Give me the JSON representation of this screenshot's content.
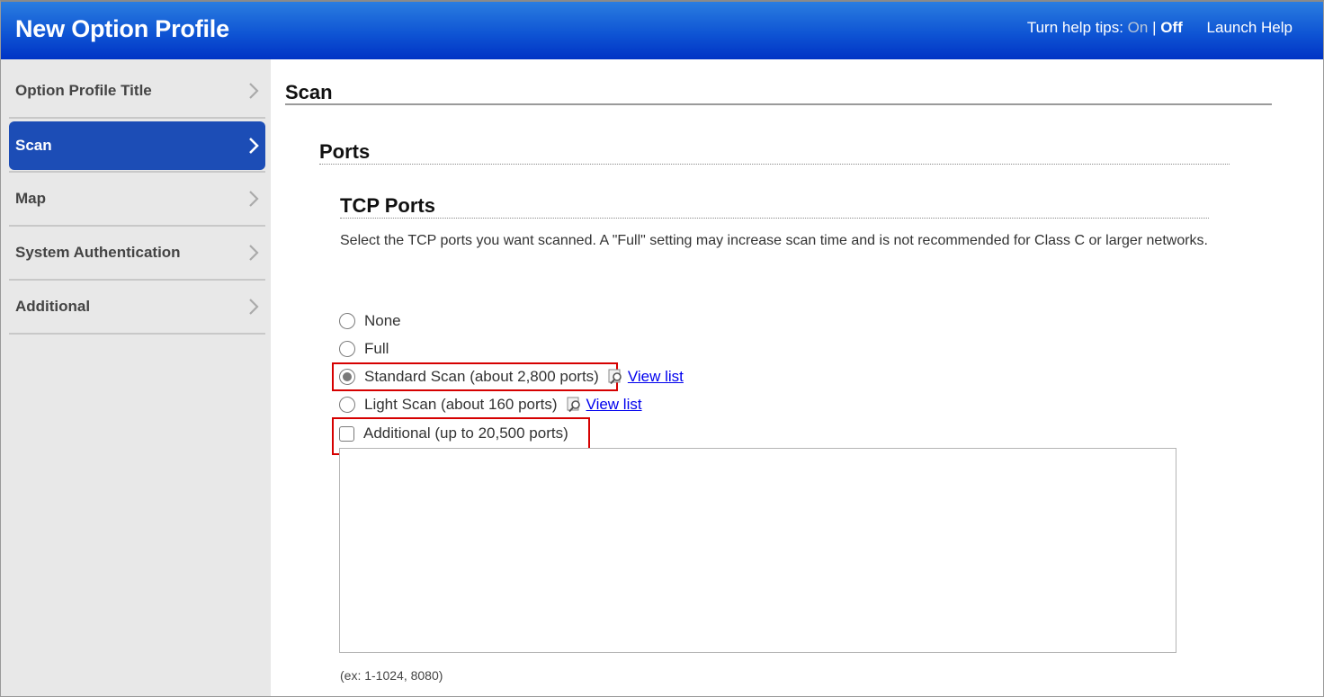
{
  "header": {
    "title": "New Option Profile",
    "help_tips_label": "Turn help tips:",
    "help_on": "On",
    "help_separator": "|",
    "help_off": "Off",
    "help_tips_state": "Off",
    "launch_help": "Launch Help"
  },
  "sidebar": {
    "items": [
      {
        "label": "Option Profile Title",
        "active": false
      },
      {
        "label": "Scan",
        "active": true
      },
      {
        "label": "Map",
        "active": false
      },
      {
        "label": "System Authentication",
        "active": false
      },
      {
        "label": "Additional",
        "active": false
      }
    ]
  },
  "main": {
    "section_title": "Scan",
    "subsection_title": "Ports",
    "group_title": "TCP Ports",
    "description": "Select the TCP ports you want scanned. A \"Full\" setting may increase scan time and is not recommended for Class C or larger networks.",
    "options": [
      {
        "label": "None",
        "type": "radio",
        "checked": false
      },
      {
        "label": "Full",
        "type": "radio",
        "checked": false
      },
      {
        "label": "Standard Scan (about 2,800 ports)",
        "type": "radio",
        "checked": true,
        "link": "View list",
        "highlighted": true
      },
      {
        "label": "Light Scan (about 160 ports)",
        "type": "radio",
        "checked": false,
        "link": "View list"
      },
      {
        "label": "Additional (up to 20,500 ports)",
        "type": "checkbox",
        "checked": false,
        "highlighted": true
      }
    ],
    "additional_ports_value": "",
    "additional_ports_hint": "(ex: 1-1024, 8080)"
  },
  "colors": {
    "header_top": "#2a7de0",
    "header_bottom": "#0033c5",
    "sidebar_bg": "#e8e8e8",
    "active_nav": "#1c4db6",
    "highlight_border": "#d60000",
    "link": "#0000ee"
  },
  "icons": {
    "nav_chevron": "chevron-right-icon",
    "view_list": "magnifier-icon"
  }
}
